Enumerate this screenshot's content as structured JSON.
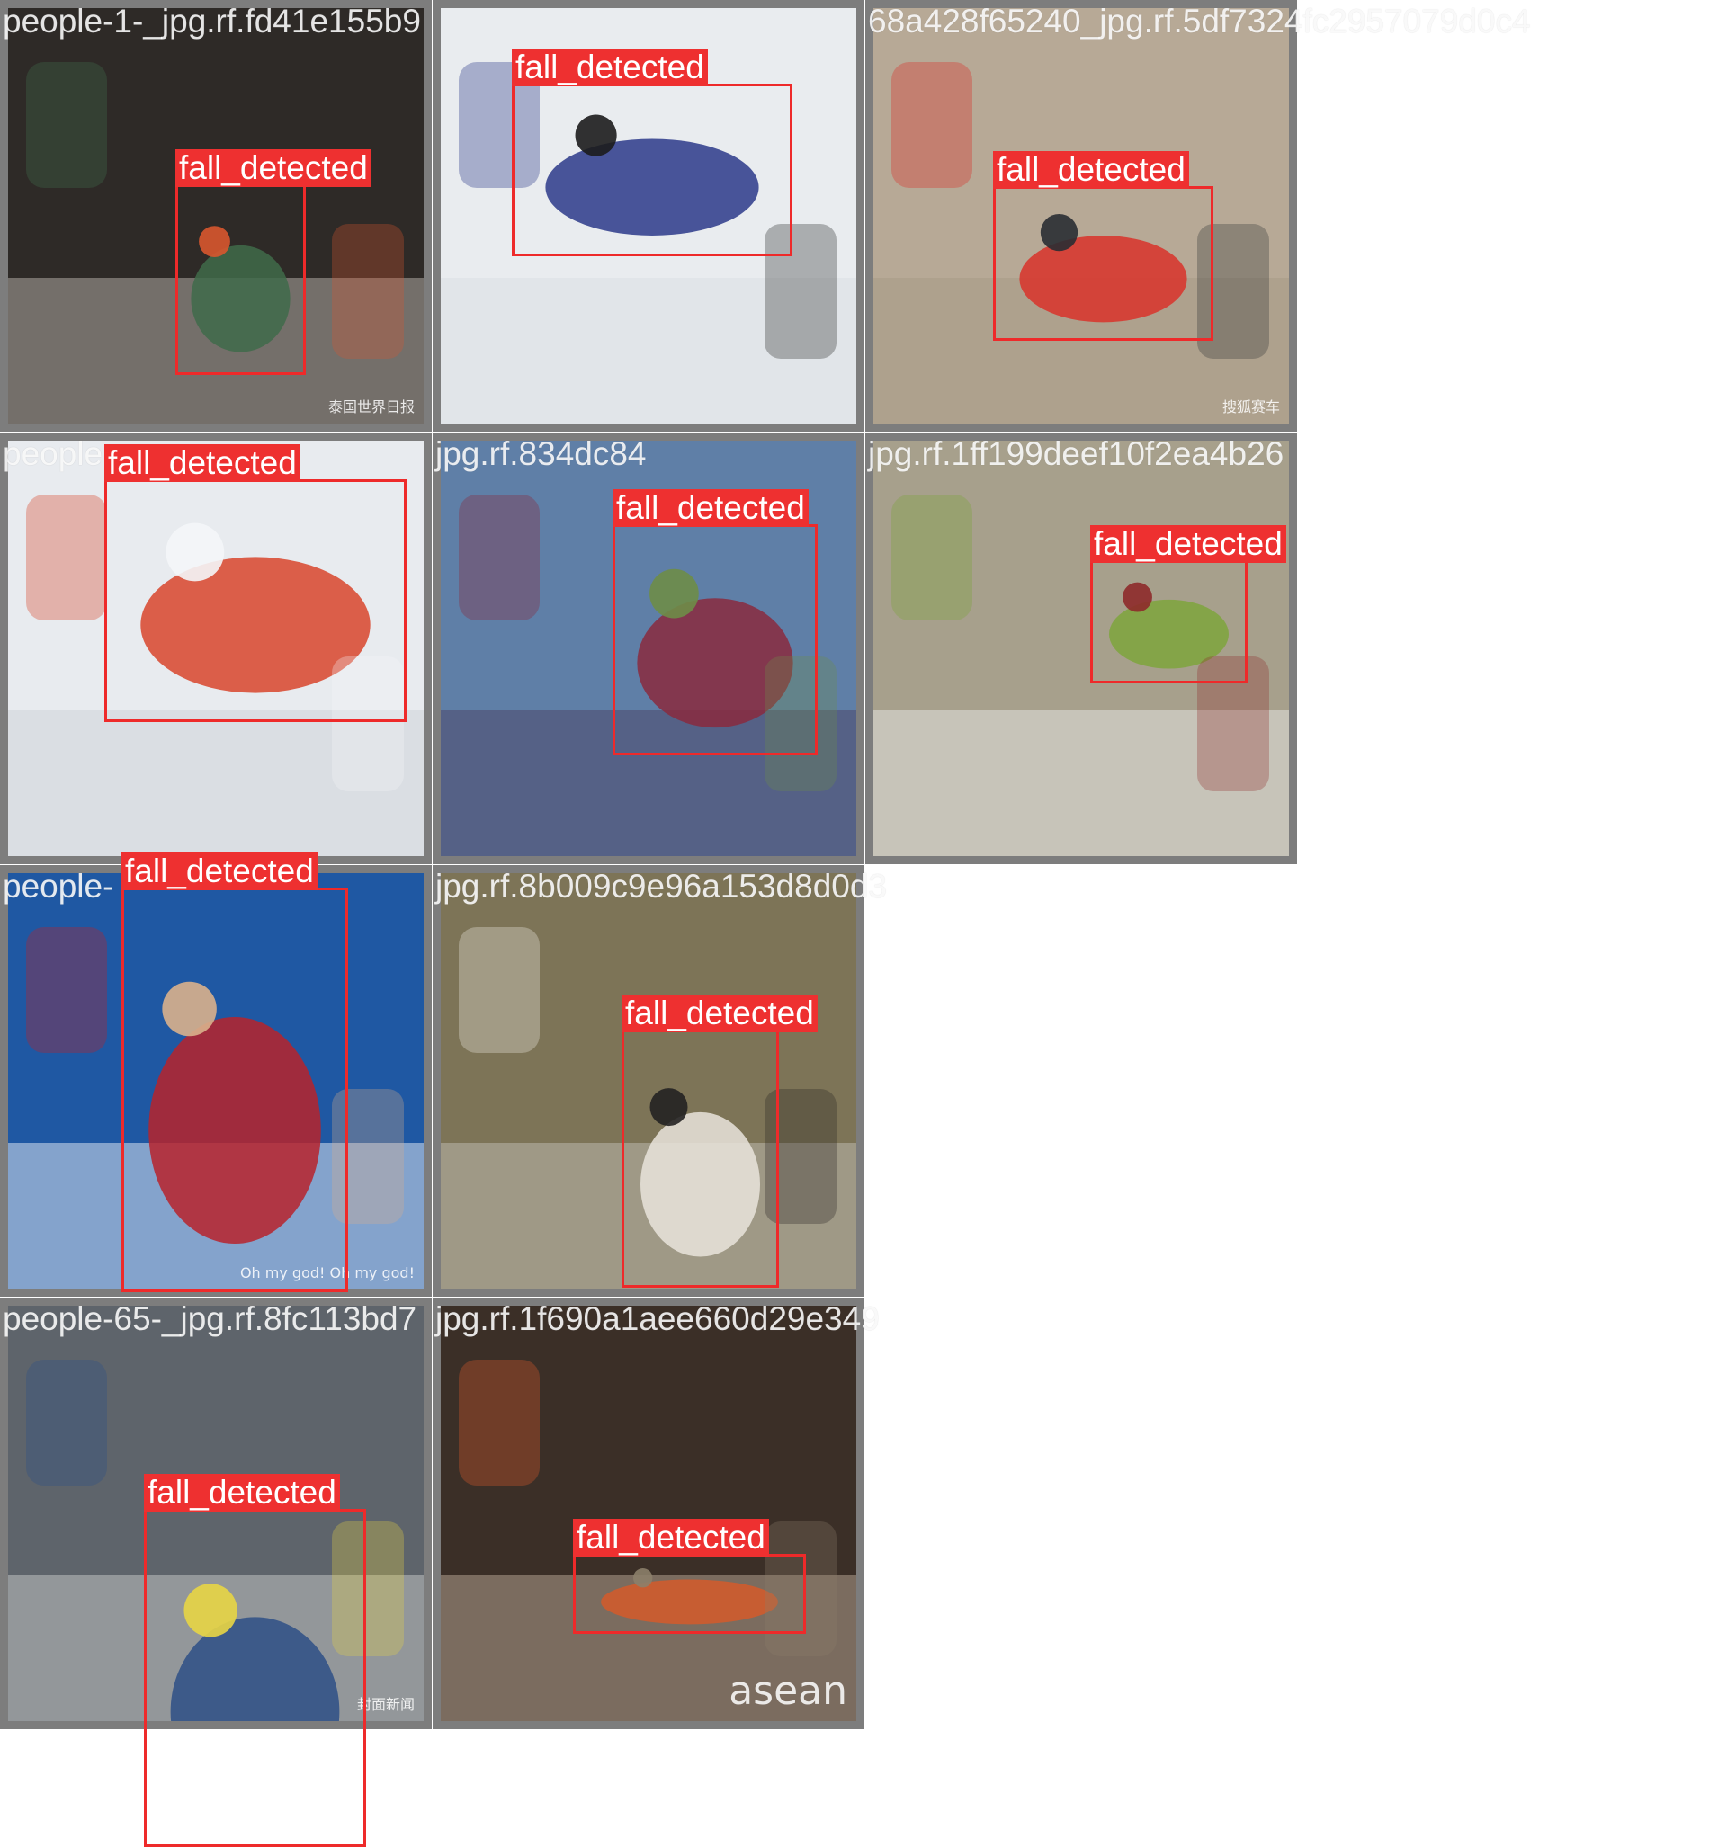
{
  "colors": {
    "box": "#ee2a2a",
    "label_bg": "#ee3030",
    "label_text": "#ffffff",
    "border": "#7d7d7d"
  },
  "tiles": [
    {
      "filename": "people-1-_jpg.rf.fd41e155b9",
      "label": "fall_detected",
      "watermark": "泰国世界日报",
      "palette": {
        "bg": "#2e2a27",
        "a": "#3f6b4a",
        "b": "#d8562f",
        "c": "#c9c3bd"
      }
    },
    {
      "filename": "",
      "label": "fall_detected",
      "watermark": "",
      "palette": {
        "bg": "#e9ecef",
        "a": "#2c3a8a",
        "b": "#1c1c1c",
        "c": "#d8dde2"
      }
    },
    {
      "filename": "68a428f65240_jpg.rf.5df7324fc2957079d0c4",
      "label": "fall_detected",
      "watermark": "搜狐赛车",
      "palette": {
        "bg": "#b7a996",
        "a": "#d9322a",
        "b": "#2a2d33",
        "c": "#a59783"
      }
    },
    {
      "filename": "people",
      "label": "fall_detected",
      "watermark": "",
      "palette": {
        "bg": "#e8ebef",
        "a": "#d8452c",
        "b": "#f4f6f8",
        "c": "#c9ced4"
      }
    },
    {
      "filename": "jpg.rf.834dc84",
      "label": "fall_detected",
      "watermark": "",
      "palette": {
        "bg": "#5f7fa7",
        "a": "#8a2a3e",
        "b": "#6e8d48",
        "c": "#4a3f5f"
      }
    },
    {
      "filename": "jpg.rf.1ff199deef10f2ea4b26",
      "label": "fall_detected",
      "watermark": "",
      "palette": {
        "bg": "#a7a08c",
        "a": "#7ea43c",
        "b": "#8e2a2a",
        "c": "#f0f0f0"
      }
    },
    {
      "filename": "people-",
      "label": "fall_detected",
      "watermark": "Oh my god! Oh my god!",
      "palette": {
        "bg": "#1f58a3",
        "a": "#b7232b",
        "b": "#d9b18c",
        "c": "#ffffff"
      }
    },
    {
      "filename": "jpg.rf.8b009c9e96a153d8d0d3",
      "label": "fall_detected",
      "watermark": "",
      "palette": {
        "bg": "#7d7457",
        "a": "#e9e4dc",
        "b": "#242222",
        "c": "#c9c7c0"
      }
    },
    {
      "filename": "people-65-_jpg.rf.8fc113bd7",
      "label": "fall_detected",
      "watermark": "封面新闻",
      "palette": {
        "bg": "#5e646b",
        "a": "#2e4f86",
        "b": "#e8d545",
        "c": "#d4d4d4"
      }
    },
    {
      "filename": "jpg.rf.1f690a1aee660d29e349",
      "label": "fall_detected",
      "watermark": "asean",
      "palette": {
        "bg": "#3b2f27",
        "a": "#d55a2a",
        "b": "#8c7f6a",
        "c": "#c9b8a3"
      }
    }
  ]
}
